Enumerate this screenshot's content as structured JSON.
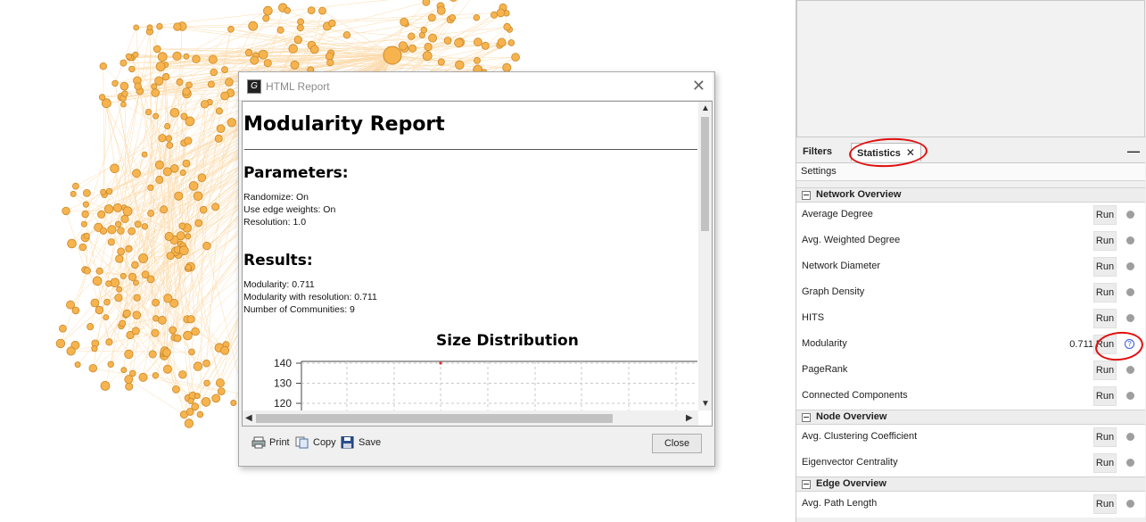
{
  "right_panel": {
    "tabs": {
      "filters": "Filters",
      "statistics": "Statistics",
      "statistics_close": "✕",
      "minimize": "—"
    },
    "settings_label": "Settings",
    "sections": [
      {
        "title": "Network Overview",
        "rows": [
          {
            "label": "Average Degree",
            "value": "",
            "run": "Run",
            "status": "dot"
          },
          {
            "label": "Avg. Weighted Degree",
            "value": "",
            "run": "Run",
            "status": "dot"
          },
          {
            "label": "Network Diameter",
            "value": "",
            "run": "Run",
            "status": "dot"
          },
          {
            "label": "Graph Density",
            "value": "",
            "run": "Run",
            "status": "dot"
          },
          {
            "label": "HITS",
            "value": "",
            "run": "Run",
            "status": "dot"
          },
          {
            "label": "Modularity",
            "value": "0.711",
            "run": "Run",
            "status": "help"
          },
          {
            "label": "PageRank",
            "value": "",
            "run": "Run",
            "status": "dot"
          },
          {
            "label": "Connected Components",
            "value": "",
            "run": "Run",
            "status": "dot"
          }
        ]
      },
      {
        "title": "Node Overview",
        "rows": [
          {
            "label": "Avg. Clustering Coefficient",
            "value": "",
            "run": "Run",
            "status": "dot"
          },
          {
            "label": "Eigenvector Centrality",
            "value": "",
            "run": "Run",
            "status": "dot"
          }
        ]
      },
      {
        "title": "Edge Overview",
        "rows": [
          {
            "label": "Avg. Path Length",
            "value": "",
            "run": "Run",
            "status": "dot"
          }
        ]
      }
    ]
  },
  "dialog": {
    "title": "HTML Report",
    "close_glyph": "✕",
    "report": {
      "title": "Modularity Report",
      "parameters_heading": "Parameters:",
      "parameters": [
        "Randomize: On",
        "Use edge weights: On",
        "Resolution: 1.0"
      ],
      "results_heading": "Results:",
      "results": [
        "Modularity: 0.711",
        "Modularity with resolution: 0.711",
        "Number of Communities: 9"
      ]
    },
    "footer": {
      "print": "Print",
      "copy": "Copy",
      "save": "Save",
      "close": "Close"
    }
  },
  "chart_data": {
    "type": "scatter",
    "title": "Size Distribution",
    "y_ticks_visible": [
      140,
      130,
      120
    ],
    "series": [
      {
        "points": [
          {
            "y": 140
          }
        ]
      }
    ],
    "grid": true
  },
  "colors": {
    "node_fill": "#f7b34e",
    "node_stroke": "#c98a2a",
    "edge": "#fbd39a",
    "annotation": "#e01010",
    "point": "#e03030"
  }
}
